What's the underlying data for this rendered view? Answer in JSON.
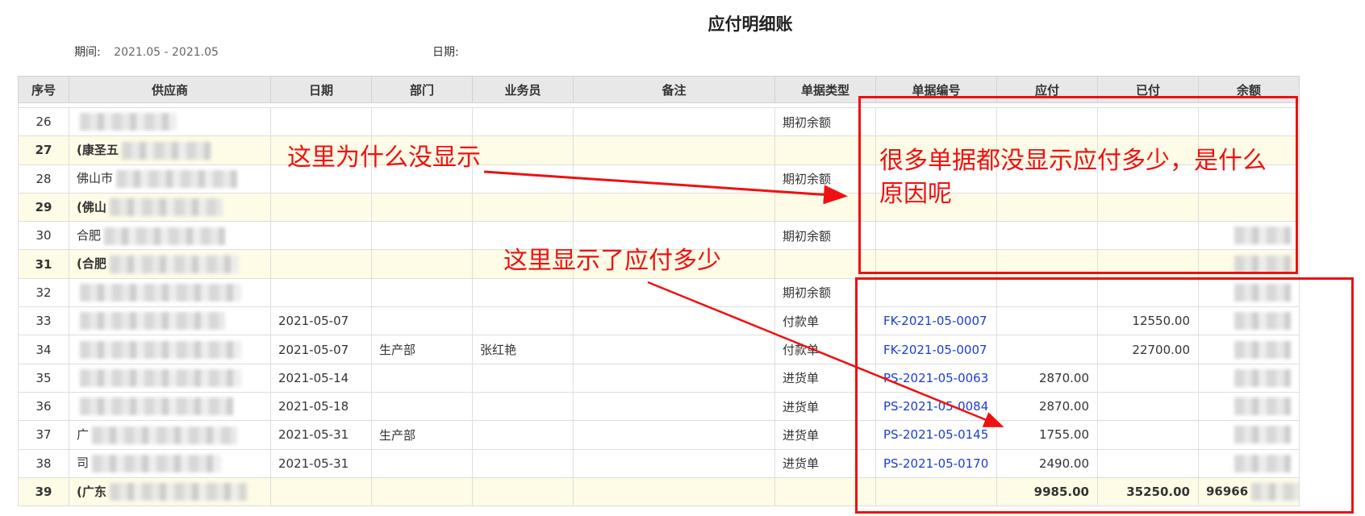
{
  "report": {
    "title": "应付明细账",
    "period_label": "期间:",
    "period_value": "2021.05 - 2021.05",
    "date_label": "日期:"
  },
  "table": {
    "headers": [
      "序号",
      "供应商",
      "日期",
      "部门",
      "业务员",
      "备注",
      "单据类型",
      "单据编号",
      "应付",
      "已付",
      "余额"
    ],
    "rows": [
      {
        "no": "26",
        "supplier": "",
        "date": "",
        "dept": "",
        "staff": "",
        "note": "",
        "doc_type": "期初余额",
        "doc_no": "",
        "payable": "",
        "paid": "",
        "balance": ""
      },
      {
        "no": "27",
        "supplier": "(康圣五",
        "date": "",
        "dept": "",
        "staff": "",
        "note": "",
        "doc_type": "",
        "doc_no": "",
        "payable": "",
        "paid": "",
        "balance": ""
      },
      {
        "no": "28",
        "supplier": "佛山市",
        "date": "",
        "dept": "",
        "staff": "",
        "note": "",
        "doc_type": "期初余额",
        "doc_no": "",
        "payable": "",
        "paid": "",
        "balance": ""
      },
      {
        "no": "29",
        "supplier": "(佛山",
        "date": "",
        "dept": "",
        "staff": "",
        "note": "",
        "doc_type": "",
        "doc_no": "",
        "payable": "",
        "paid": "",
        "balance": ""
      },
      {
        "no": "30",
        "supplier": "合肥",
        "date": "",
        "dept": "",
        "staff": "",
        "note": "",
        "doc_type": "期初余额",
        "doc_no": "",
        "payable": "",
        "paid": "",
        "balance": ""
      },
      {
        "no": "31",
        "supplier": "(合肥",
        "date": "",
        "dept": "",
        "staff": "",
        "note": "",
        "doc_type": "",
        "doc_no": "",
        "payable": "",
        "paid": "",
        "balance": ""
      },
      {
        "no": "32",
        "supplier": "",
        "date": "",
        "dept": "",
        "staff": "",
        "note": "",
        "doc_type": "期初余额",
        "doc_no": "",
        "payable": "",
        "paid": "",
        "balance": ""
      },
      {
        "no": "33",
        "supplier": "",
        "date": "2021-05-07",
        "dept": "",
        "staff": "",
        "note": "",
        "doc_type": "付款单",
        "doc_no": "FK-2021-05-0007",
        "payable": "",
        "paid": "12550.00",
        "balance": ""
      },
      {
        "no": "34",
        "supplier": "",
        "date": "2021-05-07",
        "dept": "生产部",
        "staff": "张红艳",
        "note": "",
        "doc_type": "付款单",
        "doc_no": "FK-2021-05-0007",
        "payable": "",
        "paid": "22700.00",
        "balance": ""
      },
      {
        "no": "35",
        "supplier": "",
        "date": "2021-05-14",
        "dept": "",
        "staff": "",
        "note": "",
        "doc_type": "进货单",
        "doc_no": "PS-2021-05-0063",
        "payable": "2870.00",
        "paid": "",
        "balance": ""
      },
      {
        "no": "36",
        "supplier": "",
        "date": "2021-05-18",
        "dept": "",
        "staff": "",
        "note": "",
        "doc_type": "进货单",
        "doc_no": "PS-2021-05-0084",
        "payable": "2870.00",
        "paid": "",
        "balance": ""
      },
      {
        "no": "37",
        "supplier": "广",
        "date": "2021-05-31",
        "dept": "生产部",
        "staff": "",
        "note": "",
        "doc_type": "进货单",
        "doc_no": "PS-2021-05-0145",
        "payable": "1755.00",
        "paid": "",
        "balance": ""
      },
      {
        "no": "38",
        "supplier": "司",
        "date": "2021-05-31",
        "dept": "",
        "staff": "",
        "note": "",
        "doc_type": "进货单",
        "doc_no": "PS-2021-05-0170",
        "payable": "2490.00",
        "paid": "",
        "balance": ""
      },
      {
        "no": "39",
        "supplier": "(广东",
        "date": "",
        "dept": "",
        "staff": "",
        "note": "",
        "doc_type": "",
        "doc_no": "",
        "payable": "9985.00",
        "paid": "35250.00",
        "balance": "96966"
      }
    ]
  },
  "annotations": {
    "note1": "这里为什么没显示",
    "note2": "这里显示了应付多少",
    "note3": "很多单据都没显示应付多少，是什么原因呢",
    "color": "#ee1111"
  },
  "colors": {
    "link": "#1a3cd6",
    "subtotal_bg": "#fefbe6",
    "header_bg": "#e8e8e8"
  }
}
